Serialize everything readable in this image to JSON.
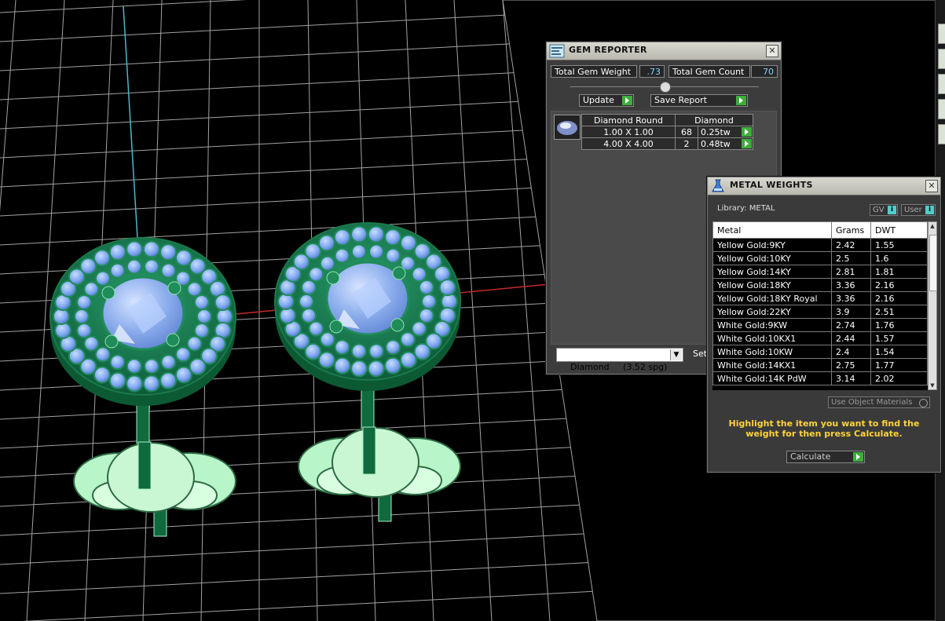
{
  "gem_reporter": {
    "title": "GEM REPORTER",
    "close": "✕",
    "total_gem_weight_label": "Total Gem Weight",
    "total_gem_weight_value": ".73",
    "total_gem_count_label": "Total Gem Count",
    "total_gem_count_value": "70",
    "update_label": "Update",
    "save_report_label": "Save Report",
    "table_header": [
      "Diamond Round",
      "Diamond"
    ],
    "rows": [
      {
        "size": "1.00 X 1.00",
        "count": "68",
        "weight": "0.25tw"
      },
      {
        "size": "4.00 X 4.00",
        "count": "2",
        "weight": "0.48tw"
      }
    ],
    "material_select": "Diamond     (3.52 spg)",
    "set_button": "Set"
  },
  "metal_weights": {
    "title": "METAL WEIGHTS",
    "close": "✕",
    "library_label": "Library: METAL",
    "gv_label": "GV",
    "user_label": "User",
    "info_icon_text": "i",
    "columns": [
      "Metal",
      "Grams",
      "DWT"
    ],
    "rows": [
      {
        "metal": "Yellow Gold:9KY",
        "grams": "2.42",
        "dwt": "1.55"
      },
      {
        "metal": "Yellow Gold:10KY",
        "grams": "2.5",
        "dwt": "1.6"
      },
      {
        "metal": "Yellow Gold:14KY",
        "grams": "2.81",
        "dwt": "1.81"
      },
      {
        "metal": "Yellow Gold:18KY",
        "grams": "3.36",
        "dwt": "2.16"
      },
      {
        "metal": "Yellow Gold:18KY Royal",
        "grams": "3.36",
        "dwt": "2.16"
      },
      {
        "metal": "Yellow Gold:22KY",
        "grams": "3.9",
        "dwt": "2.51"
      },
      {
        "metal": "White Gold:9KW",
        "grams": "2.74",
        "dwt": "1.76"
      },
      {
        "metal": "White Gold:10KX1",
        "grams": "2.44",
        "dwt": "1.57"
      },
      {
        "metal": "White Gold:10KW",
        "grams": "2.4",
        "dwt": "1.54"
      },
      {
        "metal": "White Gold:14KX1",
        "grams": "2.75",
        "dwt": "1.77"
      },
      {
        "metal": "White Gold:14K PdW",
        "grams": "3.14",
        "dwt": "2.02"
      }
    ],
    "use_object_materials_label": "Use Object Materials",
    "hint_text": "Highlight the item you want to find the weight for then press Calculate.",
    "calculate_label": "Calculate"
  },
  "colors": {
    "accent_green": "#3cae3c",
    "hint_yellow": "#ffd33a",
    "value_cyan": "#7fd6ff",
    "model_green": "#1f8c5a",
    "gem_blue": "#7fa8f0"
  }
}
